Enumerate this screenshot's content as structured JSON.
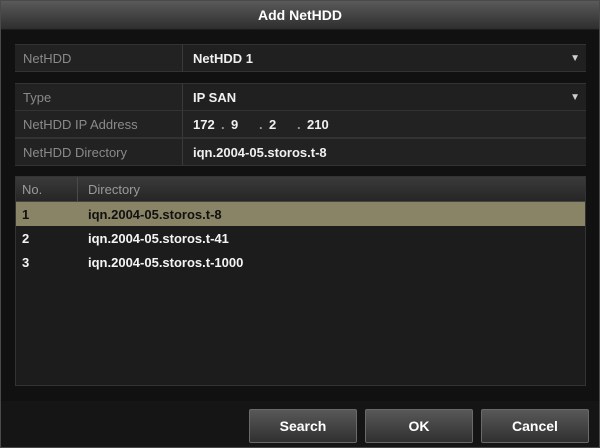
{
  "dialog": {
    "title": "Add NetHDD"
  },
  "fields": {
    "nethdd": {
      "label": "NetHDD",
      "value": "NetHDD 1"
    },
    "type": {
      "label": "Type",
      "value": "IP SAN"
    },
    "ip": {
      "label": "NetHDD IP Address",
      "seg1": "172",
      "seg2": "9",
      "seg3": "2",
      "seg4": "210"
    },
    "directory": {
      "label": "NetHDD Directory",
      "value": "iqn.2004-05.storos.t-8"
    }
  },
  "table": {
    "headers": {
      "no": "No.",
      "directory": "Directory"
    },
    "rows": [
      {
        "no": "1",
        "directory": "iqn.2004-05.storos.t-8"
      },
      {
        "no": "2",
        "directory": "iqn.2004-05.storos.t-41"
      },
      {
        "no": "3",
        "directory": "iqn.2004-05.storos.t-1000"
      }
    ]
  },
  "buttons": {
    "search": "Search",
    "ok": "OK",
    "cancel": "Cancel"
  },
  "icons": {
    "dropdown": "chevron-down-icon"
  },
  "colors": {
    "selected_row": "#8a8466",
    "titlebar": "#4a4a4a"
  }
}
